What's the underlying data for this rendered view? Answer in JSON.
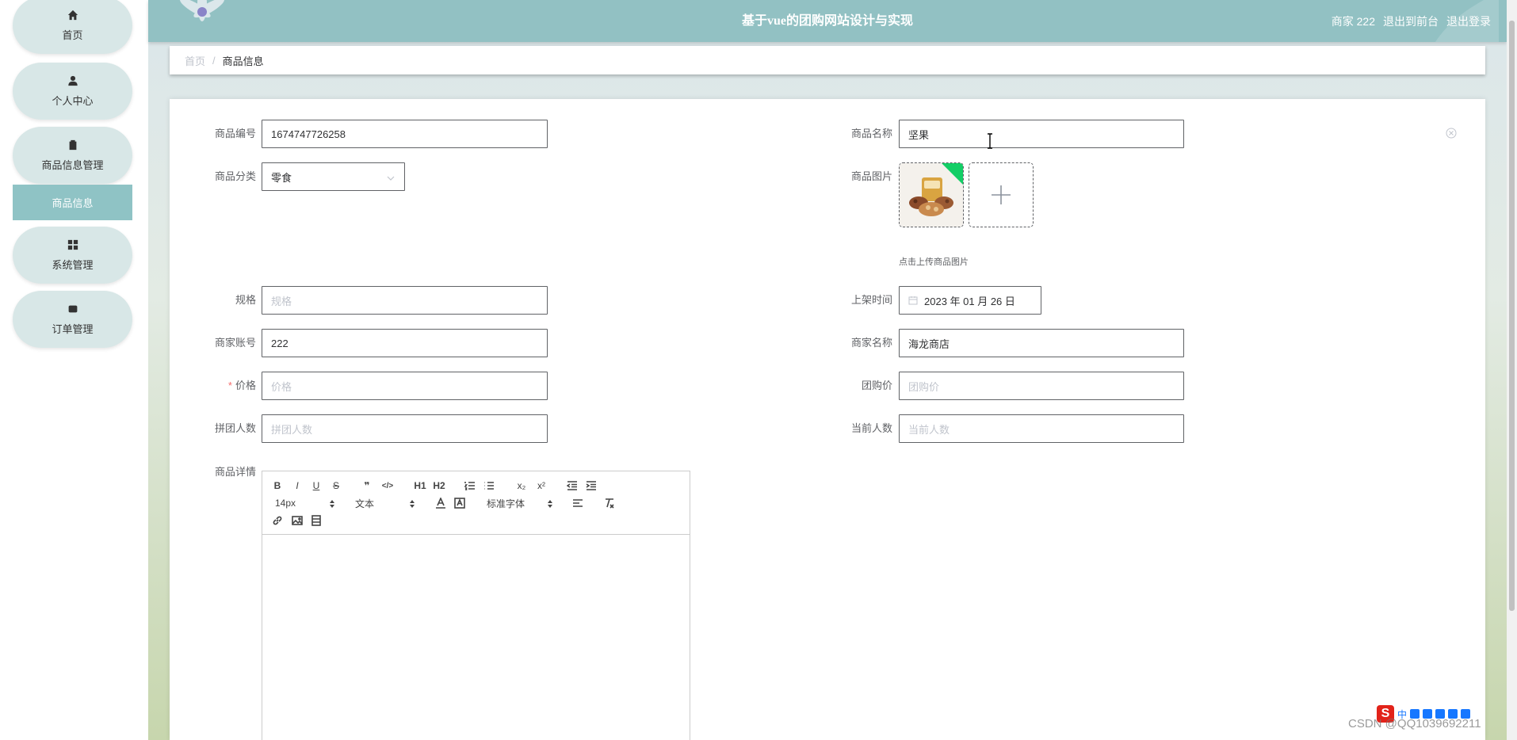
{
  "app": {
    "title": "基于vue的团购网站设计与实现",
    "user_info": "商家 222",
    "back_to_front": "退出到前台",
    "logout": "退出登录"
  },
  "sidebar": {
    "items": [
      {
        "label": "首页",
        "icon": "home-icon"
      },
      {
        "label": "个人中心",
        "icon": "user-icon"
      },
      {
        "label": "商品信息管理",
        "icon": "clipboard-icon"
      },
      {
        "label": "系统管理",
        "icon": "grid-icon"
      },
      {
        "label": "订单管理",
        "icon": "box-icon"
      }
    ],
    "active_sub": "商品信息"
  },
  "breadcrumb": {
    "home": "首页",
    "separator": "/",
    "current": "商品信息"
  },
  "form": {
    "product_code": {
      "label": "商品编号",
      "value": "1674747726258"
    },
    "product_name": {
      "label": "商品名称",
      "value": "坚果"
    },
    "category": {
      "label": "商品分类",
      "value": "零食"
    },
    "product_image": {
      "label": "商品图片",
      "tip": "点击上传商品图片"
    },
    "spec": {
      "label": "规格",
      "placeholder": "规格"
    },
    "listing_time": {
      "label": "上架时间",
      "value": "2023 年 01 月 26 日"
    },
    "merchant_account": {
      "label": "商家账号",
      "value": "222"
    },
    "merchant_name": {
      "label": "商家名称",
      "value": "海龙商店"
    },
    "price": {
      "label": "价格",
      "required": "*",
      "placeholder": "价格"
    },
    "group_price": {
      "label": "团购价",
      "placeholder": "团购价"
    },
    "group_size": {
      "label": "拼团人数",
      "placeholder": "拼团人数"
    },
    "current_count": {
      "label": "当前人数",
      "placeholder": "当前人数"
    },
    "details": {
      "label": "商品详情"
    }
  },
  "editor": {
    "buttons_row1": [
      "B",
      "I",
      "U",
      "S",
      "❞",
      "</>",
      "H1",
      "H2",
      "ol",
      "ul",
      "x₂",
      "x²",
      "outdent",
      "indent"
    ],
    "font_size": "14px",
    "block_type": "文本",
    "font_family": "标准字体"
  },
  "watermark": "CSDN @QQ1039692211",
  "tray": {
    "ime_label": "中"
  }
}
